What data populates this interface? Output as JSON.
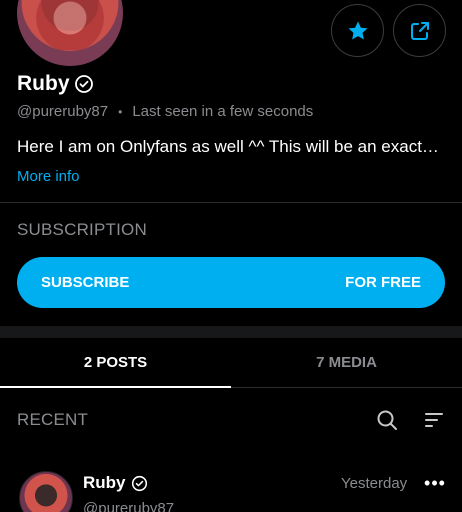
{
  "profile": {
    "name": "Ruby",
    "handle": "@pureruby87",
    "separator": "•",
    "last_seen": "Last seen in a few seconds",
    "bio": "Here I am on Onlyfans as well ^^ This will be an exact…",
    "more_info_label": "More info"
  },
  "actions": {
    "favorite_icon": "star-icon",
    "share_icon": "share-icon"
  },
  "subscription": {
    "section_label": "SUBSCRIPTION",
    "button_label": "SUBSCRIBE",
    "price_label": "FOR FREE"
  },
  "tabs": [
    {
      "label": "2 POSTS",
      "active": true
    },
    {
      "label": "7 MEDIA",
      "active": false
    }
  ],
  "feed": {
    "section_label": "RECENT",
    "search_icon": "search-icon",
    "sort_icon": "sort-icon"
  },
  "post": {
    "author_name": "Ruby",
    "author_handle": "@pureruby87",
    "timestamp": "Yesterday",
    "more_label": "•••"
  },
  "colors": {
    "accent": "#00aff0",
    "background": "#000000",
    "muted_text": "#8a8c90",
    "divider": "#2a2c2e"
  }
}
